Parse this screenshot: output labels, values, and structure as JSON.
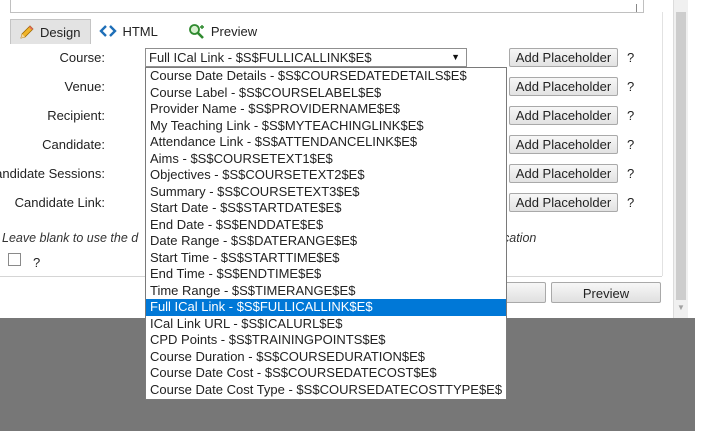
{
  "tabs": [
    {
      "label": "Design",
      "icon": "pencil-icon",
      "active": true
    },
    {
      "label": "HTML",
      "icon": "code-icon",
      "active": false
    },
    {
      "label": "Preview",
      "icon": "magnifier-icon",
      "active": false
    }
  ],
  "form": {
    "course_label": "Course:",
    "venue_label": "Venue:",
    "recipient_label": "Recipient:",
    "candidate_label": "Candidate:",
    "candidate_sessions_label": "Candidate Sessions:",
    "candidate_link_label": "Candidate Link:",
    "add_placeholder": "Add Placeholder",
    "help": "?",
    "course_selected": "Full ICal Link - $S$FULLICALLINK$E$"
  },
  "dropdown": {
    "options": [
      "Course Date Details - $S$COURSEDATEDETAILS$E$",
      "Course Label - $S$COURSELABEL$E$",
      "Provider Name - $S$PROVIDERNAME$E$",
      "My Teaching Link - $S$MYTEACHINGLINK$E$",
      "Attendance Link - $S$ATTENDANCELINK$E$",
      "Aims - $S$COURSETEXT1$E$",
      "Objectives - $S$COURSETEXT2$E$",
      "Summary - $S$COURSETEXT3$E$",
      "Start Date - $S$STARTDATE$E$",
      "End Date - $S$ENDDATE$E$",
      "Date Range - $S$DATERANGE$E$",
      "Start Time - $S$STARTTIME$E$",
      "End Time - $S$ENDTIME$E$",
      "Time Range - $S$TIMERANGE$E$",
      "Full ICal Link - $S$FULLICALLINK$E$",
      "ICal Link URL - $S$ICALURL$E$",
      "CPD Points - $S$TRAININGPOINTS$E$",
      "Course Duration - $S$COURSEDURATION$E$",
      "Course Date Cost - $S$COURSEDATECOST$E$",
      "Course Date Cost Type - $S$COURSEDATECOSTTYPE$E$"
    ],
    "selected_index": 14
  },
  "hint": {
    "left": "Leave blank to use the d",
    "right": "cation"
  },
  "checkbox": {
    "checked": false,
    "help": "?"
  },
  "footer": {
    "preview_label": "Preview"
  },
  "colors": {
    "selection": "#0078d7",
    "overlay": "#777777"
  }
}
